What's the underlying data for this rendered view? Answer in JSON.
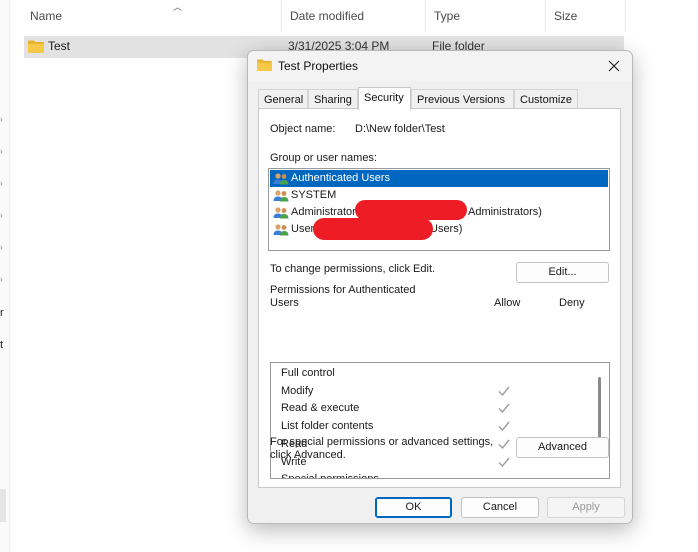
{
  "explorer": {
    "columns": {
      "name": "Name",
      "date_modified": "Date modified",
      "type": "Type",
      "size": "Size"
    },
    "row": {
      "name": "Test",
      "date_modified": "3/31/2025 3:04 PM",
      "type": "File folder"
    },
    "nav_fragments": [
      "r",
      "t"
    ]
  },
  "dialog": {
    "title": "Test Properties",
    "tabs": [
      {
        "label": "General"
      },
      {
        "label": "Sharing"
      },
      {
        "label": "Security",
        "active": true
      },
      {
        "label": "Previous Versions"
      },
      {
        "label": "Customize"
      }
    ],
    "object_name_label": "Object name:",
    "object_name_value": "D:\\New folder\\Test",
    "group_label": "Group or user names:",
    "users": [
      {
        "name": "Authenticated Users",
        "selected": true
      },
      {
        "name": "SYSTEM"
      },
      {
        "name": "Administrators",
        "suffix": "Administrators)"
      },
      {
        "name": "Users",
        "suffix": "Users)"
      }
    ],
    "change_text": "To change permissions, click Edit.",
    "edit_button": "Edit...",
    "permissions_label_line1": "Permissions for Authenticated",
    "permissions_label_line2": "Users",
    "allow_header": "Allow",
    "deny_header": "Deny",
    "permissions": [
      {
        "name": "Full control",
        "allow": false,
        "deny": false
      },
      {
        "name": "Modify",
        "allow": true,
        "deny": false
      },
      {
        "name": "Read & execute",
        "allow": true,
        "deny": false
      },
      {
        "name": "List folder contents",
        "allow": true,
        "deny": false
      },
      {
        "name": "Read",
        "allow": true,
        "deny": false
      },
      {
        "name": "Write",
        "allow": true,
        "deny": false
      },
      {
        "name": "Special permissions",
        "allow": false,
        "deny": false
      }
    ],
    "special_text_line1": "For special permissions or advanced settings,",
    "special_text_line2": "click Advanced.",
    "advanced_button": "Advanced",
    "ok_button": "OK",
    "cancel_button": "Cancel",
    "apply_button": "Apply"
  },
  "colors": {
    "selection": "#0067c0",
    "redaction": "#ee1c24",
    "folder": "#f5c342"
  }
}
